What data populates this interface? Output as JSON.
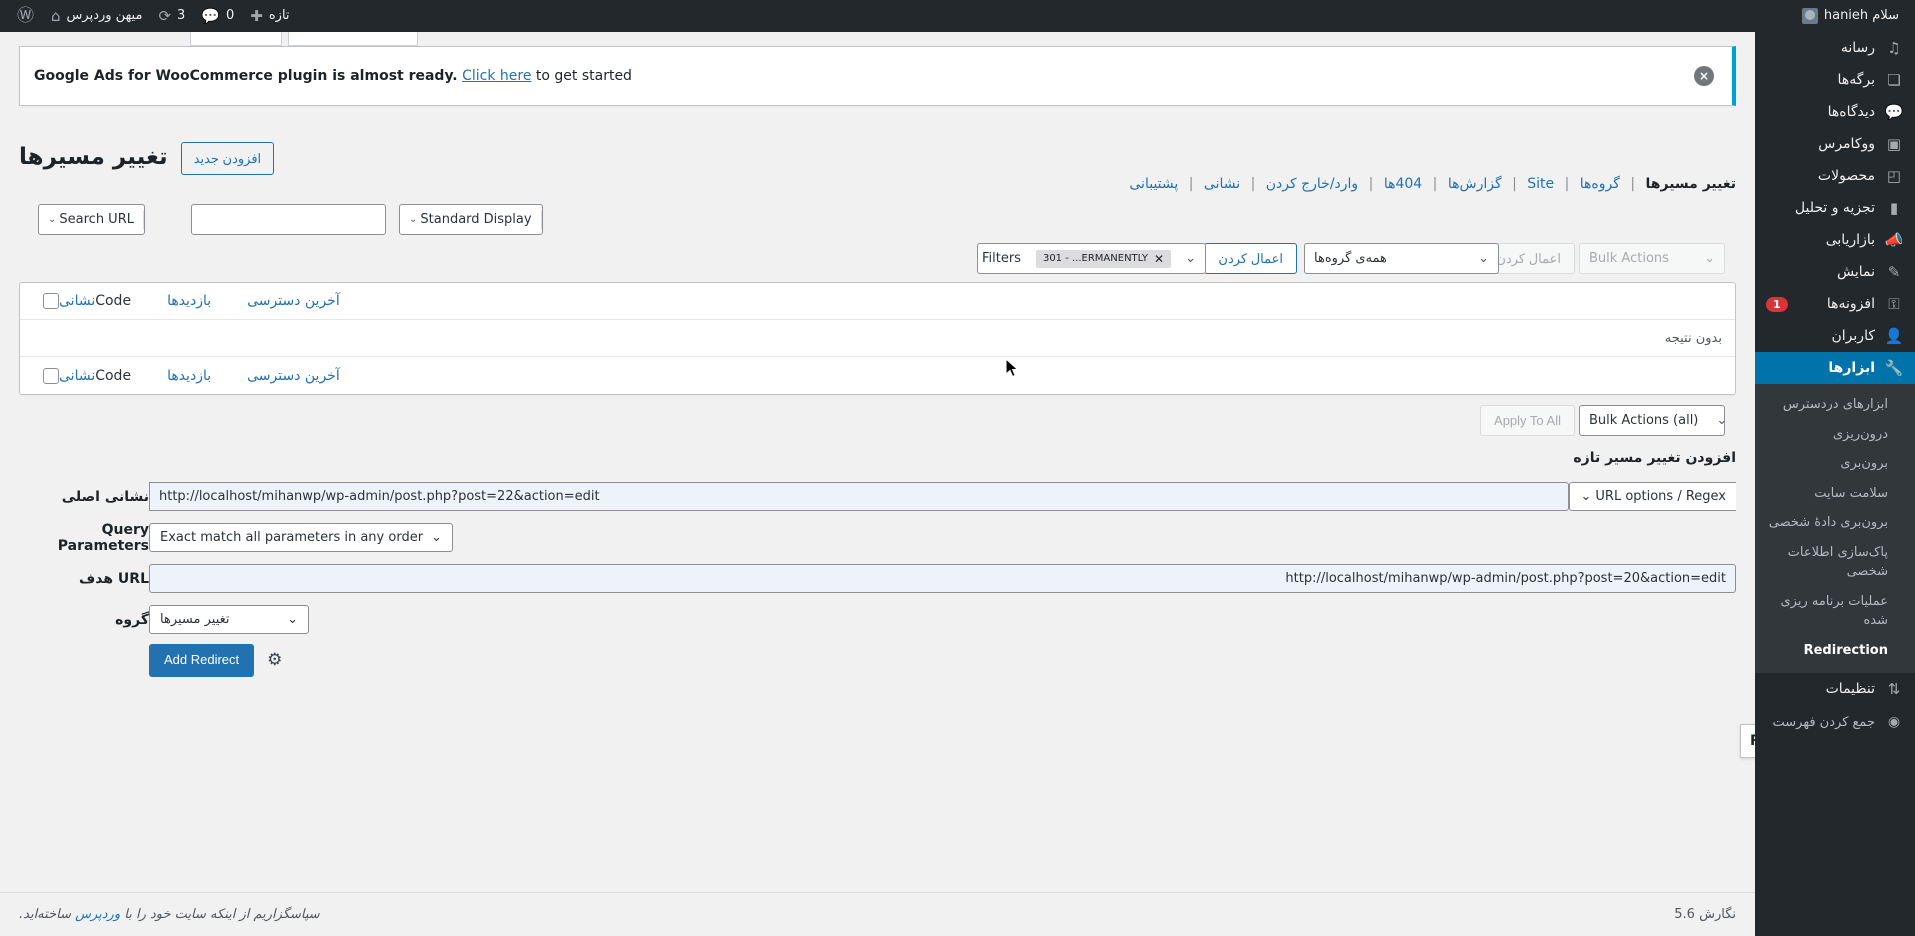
{
  "adminbar": {
    "wp_logo": "wordpress-logo-icon",
    "site_name": "میهن وردپرس",
    "updates_count": "3",
    "comments_count": "0",
    "new_label": "تازه",
    "greeting": "سلام hanieh"
  },
  "sidebar": {
    "items": [
      {
        "label": "رسانه",
        "icon": "media-icon",
        "current": false
      },
      {
        "label": "برگه‌ها",
        "icon": "pages-icon",
        "current": false
      },
      {
        "label": "دیدگاه‌ها",
        "icon": "comments-icon",
        "current": false
      },
      {
        "label": "ووکامرس",
        "icon": "woocommerce-icon",
        "current": false
      },
      {
        "label": "محصولات",
        "icon": "products-icon",
        "current": false
      },
      {
        "label": "تجزیه و تحلیل",
        "icon": "analytics-icon",
        "current": false
      },
      {
        "label": "بازاریابی",
        "icon": "marketing-icon",
        "current": false
      },
      {
        "label": "نمایش",
        "icon": "appearance-icon",
        "current": false
      },
      {
        "label": "افزونه‌ها",
        "icon": "plugins-icon",
        "badge": "1",
        "current": false
      },
      {
        "label": "کاربران",
        "icon": "users-icon",
        "current": false
      },
      {
        "label": "ابزارها",
        "icon": "tools-icon",
        "current": true
      }
    ],
    "submenu": [
      {
        "label": "ابزارهای دردسترس",
        "current": false
      },
      {
        "label": "درون‌ریزی",
        "current": false
      },
      {
        "label": "برون‌بری",
        "current": false
      },
      {
        "label": "سلامت سایت",
        "current": false
      },
      {
        "label": "برون‌بری دادهٔ شخصی",
        "current": false
      },
      {
        "label": "پاک‌سازی اطلاعات شخصی",
        "current": false
      },
      {
        "label": "عملیات برنامه ریزی شده",
        "current": false
      },
      {
        "label": "Redirection",
        "current": true
      }
    ],
    "settings": {
      "label": "تنظیمات",
      "icon": "settings-icon"
    },
    "collapse": {
      "label": "جمع کردن فهرست",
      "icon": "collapse-icon"
    }
  },
  "notice": {
    "text_before": "Google Ads for WooCommerce plugin is almost ready.",
    "link": "Click here",
    "text_after": "to get started",
    "dismiss": "×"
  },
  "page": {
    "title": "تغییر مسیرها",
    "add_new": "افزودن جدید"
  },
  "subnav": {
    "items": [
      {
        "label": "تغییر مسیرها",
        "current": true
      },
      {
        "label": "گروه‌ها",
        "current": false
      },
      {
        "label": "Site",
        "current": false
      },
      {
        "label": "گزارش‌ها",
        "current": false
      },
      {
        "label": "404ها",
        "current": false
      },
      {
        "label": "وارد/خارج کردن",
        "current": false
      },
      {
        "label": "نشانی",
        "current": false
      },
      {
        "label": "پشتیبانی",
        "current": false
      }
    ],
    "separator": "|"
  },
  "search": {
    "select_label": "Search URL",
    "input_value": "",
    "display_label": "Standard Display"
  },
  "bulk": {
    "bulk_actions_label": "Bulk Actions",
    "apply_label": "اعمال کردن",
    "all_groups_label": "همه‌ی گروه‌ها",
    "apply_label_2": "اعمال کردن",
    "filters_label": "Filters",
    "chip_label": "301 - ...ERMANENTLY",
    "chip_close": "✕",
    "bulk_actions_all_label": "Bulk Actions (all)",
    "apply_to_all_label": "Apply To All"
  },
  "table": {
    "header": {
      "url": "نشانی",
      "code": "Code",
      "hits": "بازدیدها",
      "last_access": "آخرین دسترسی"
    },
    "empty_message": "بدون نتیجه",
    "footer": {
      "url": "نشانی",
      "code": "Code",
      "hits": "بازدیدها",
      "last_access": "آخرین دسترسی"
    }
  },
  "form": {
    "title": "افزودن تغییر مسیر تازه",
    "source_label": "نشانی اصلی",
    "source_value": "http://localhost/mihanwp/wp-admin/post.php?post=22&action=edit",
    "url_options_label": "URL options / Regex",
    "query_params_label": "Query Parameters",
    "query_params_value": "Exact match all parameters in any order",
    "target_label": "URL هدف",
    "target_value": "http://localhost/mihanwp/wp-admin/post.php?post=20&action=edit",
    "group_label": "گروه",
    "group_value": "تغییر مسیرها",
    "add_redirect_label": "Add Redirect",
    "gear_icon": "gear-icon"
  },
  "tooltip": {
    "text": "Re"
  },
  "footer": {
    "thanks_before": "سپاسگزاریم از اینکه سایت خود را با",
    "thanks_link": "وردپرس",
    "thanks_after": "ساخته‌اید.",
    "version": "نگارش 5.6"
  }
}
